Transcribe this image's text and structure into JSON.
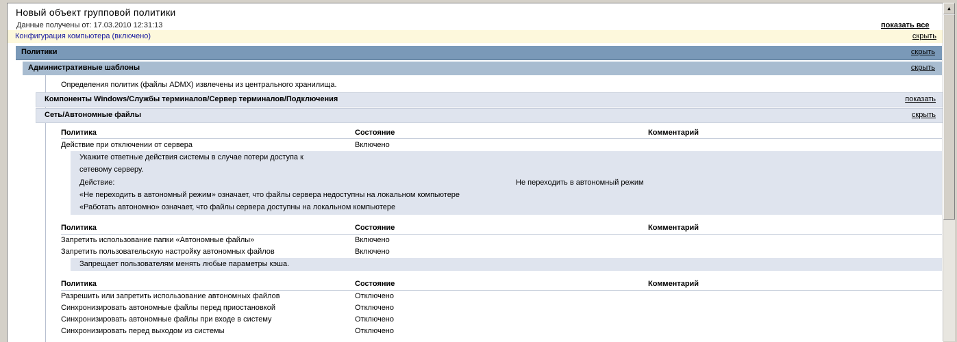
{
  "report": {
    "title": "Новый объект групповой политики",
    "received": "Данные получены от: 17.03.2010 12:31:13",
    "show_all": "показать все"
  },
  "config": {
    "label": "Конфигурация компьютера (включено)",
    "toggle": "скрыть"
  },
  "policies": {
    "label": "Политики",
    "toggle": "скрыть"
  },
  "admin": {
    "label": "Административные шаблоны",
    "toggle": "скрыть",
    "note": "Определения политик (файлы ADMX) извлечены из центрального хранилища."
  },
  "win_components": {
    "label": "Компоненты Windows/Службы терминалов/Сервер терминалов/Подключения",
    "toggle": "показать"
  },
  "network": {
    "label": "Сеть/Автономные файлы",
    "toggle": "скрыть"
  },
  "columns": {
    "policy": "Политика",
    "state": "Состояние",
    "comment": "Комментарий"
  },
  "table1": {
    "rows": [
      {
        "policy": "Действие при отключении от сервера",
        "state": "Включено"
      }
    ],
    "explain": {
      "line1": "Укажите ответные действия системы в случае потери доступа к",
      "line2": "сетевому серверу.",
      "action_label": "Действие:",
      "action_value": "Не переходить в автономный режим",
      "line4": "«Не переходить в автономный режим» означает, что файлы сервера недоступны на локальном компьютере",
      "line5": "«Работать автономно» означает, что файлы сервера доступны на локальном компьютере"
    }
  },
  "table2": {
    "rows": [
      {
        "policy": "Запретить использование папки «Автономные файлы»",
        "state": "Включено"
      },
      {
        "policy": "Запретить пользовательскую настройку автономных файлов",
        "state": "Включено"
      }
    ],
    "explain": "Запрещает пользователям менять любые параметры кэша."
  },
  "table3": {
    "rows": [
      {
        "policy": "Разрешить или запретить использование автономных файлов",
        "state": "Отключено"
      },
      {
        "policy": "Синхронизировать автономные файлы перед приостановкой",
        "state": "Отключено"
      },
      {
        "policy": "Синхронизировать автономные файлы при входе в систему",
        "state": "Отключено"
      },
      {
        "policy": "Синхронизировать перед выходом из системы",
        "state": "Отключено"
      }
    ]
  }
}
